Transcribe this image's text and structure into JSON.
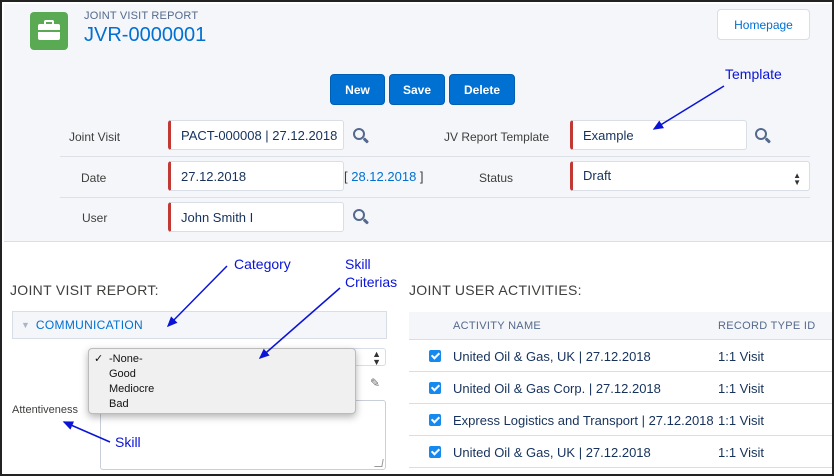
{
  "header": {
    "record_type": "JOINT VISIT REPORT",
    "record_name": "JVR-0000001",
    "homepage_label": "Homepage",
    "app_icon": "briefcase-icon"
  },
  "actions": {
    "new": "New",
    "save": "Save",
    "delete": "Delete"
  },
  "form": {
    "joint_visit_label": "Joint Visit",
    "joint_visit_value": "PACT-000008 | 27.12.2018",
    "template_label": "JV Report Template",
    "template_value": "Example",
    "date_label": "Date",
    "date_value": "27.12.2018",
    "date_link_open": "[ ",
    "date_link": "28.12.2018",
    "date_link_close": " ]",
    "status_label": "Status",
    "status_value": "Draft",
    "user_label": "User",
    "user_value": "John Smith I"
  },
  "report": {
    "section_title": "JOINT VISIT REPORT:",
    "category": "COMMUNICATION",
    "skill_label": "Attentiveness",
    "skill_options": [
      {
        "label": "-None-",
        "selected": true
      },
      {
        "label": "Good",
        "selected": false
      },
      {
        "label": "Mediocre",
        "selected": false
      },
      {
        "label": "Bad",
        "selected": false
      }
    ]
  },
  "activities": {
    "section_title": "JOINT USER ACTIVITIES:",
    "columns": [
      "ACTIVITY NAME",
      "RECORD TYPE ID"
    ],
    "rows": [
      {
        "checked": true,
        "name": "United Oil & Gas, UK | 27.12.2018",
        "type": "1:1 Visit"
      },
      {
        "checked": true,
        "name": "United Oil & Gas Corp. | 27.12.2018",
        "type": "1:1 Visit"
      },
      {
        "checked": true,
        "name": "Express Logistics and Transport | 27.12.2018",
        "type": "1:1 Visit"
      },
      {
        "checked": true,
        "name": "United Oil & Gas, UK | 27.12.2018",
        "type": "1:1 Visit"
      }
    ]
  },
  "annotations": {
    "template": "Template",
    "category": "Category",
    "skill_criterias_line1": "Skill",
    "skill_criterias_line2": "Criterias",
    "skill": "Skill",
    "color": "#0a14d6"
  }
}
